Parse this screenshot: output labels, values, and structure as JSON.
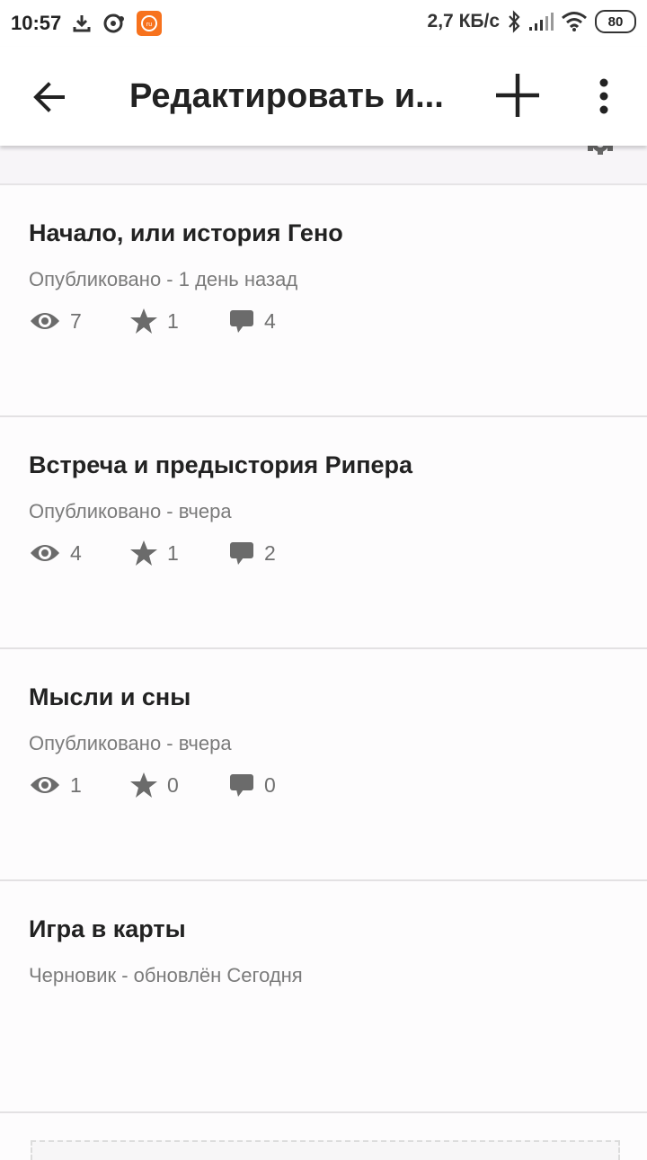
{
  "status_bar": {
    "time": "10:57",
    "speed": "2,7 КБ/с",
    "battery": "80"
  },
  "toolbar": {
    "title": "Редактировать и...",
    "back_icon": "arrow-left-icon",
    "add_icon": "plus-icon",
    "more_icon": "more-vert-icon"
  },
  "parts": [
    {
      "title": "Начало, или история Гено",
      "status": "Опубликовано - 1 день назад",
      "views": "7",
      "stars": "1",
      "comments": "4"
    },
    {
      "title": "Встреча и предыстория Рипера",
      "status": "Опубликовано - вчера",
      "views": "4",
      "stars": "1",
      "comments": "2"
    },
    {
      "title": "Мысли и сны",
      "status": "Опубликовано - вчера",
      "views": "1",
      "stars": "0",
      "comments": "0"
    },
    {
      "title": "Игра в карты",
      "status": "Черновик - обновлён Сегодня"
    }
  ],
  "colors": {
    "text_primary": "#222222",
    "text_secondary": "#7b7b7b",
    "icon_gray": "#6b6b6b",
    "notification_orange": "#f7721d"
  }
}
